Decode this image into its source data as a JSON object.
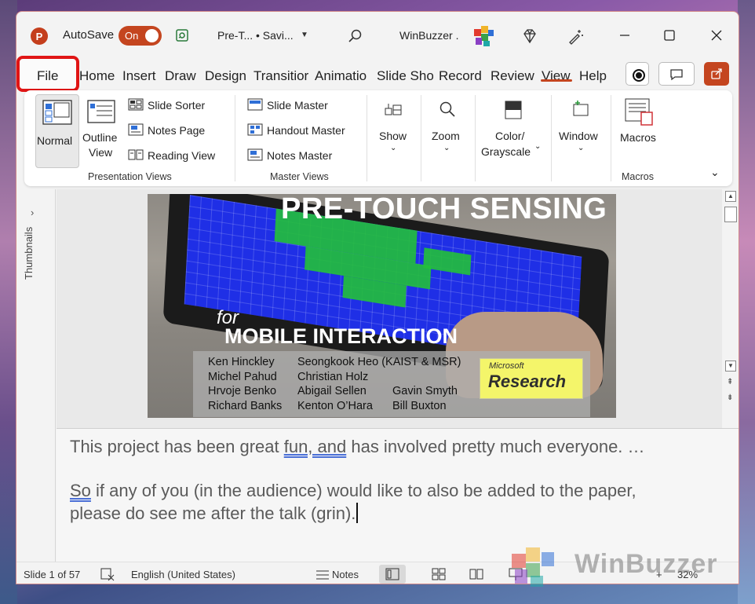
{
  "app": {
    "logo_letter": "P",
    "autosave_label": "AutoSave",
    "autosave_state": "On",
    "doc_title": "Pre-T... • Savi...",
    "user_name": "WinBuzzer ."
  },
  "tabs": [
    "File",
    "Home",
    "Insert",
    "Draw",
    "Design",
    "Transitior",
    "Animatio",
    "Slide Sho",
    "Record",
    "Review",
    "View",
    "Help"
  ],
  "active_tab": "View",
  "ribbon": {
    "presentation_views": {
      "normal": "Normal",
      "outline_line1": "Outline",
      "outline_line2": "View",
      "slide_sorter": "Slide Sorter",
      "notes_page": "Notes Page",
      "reading_view": "Reading View",
      "group_label": "Presentation Views"
    },
    "master_views": {
      "slide_master": "Slide Master",
      "handout_master": "Handout Master",
      "notes_master": "Notes Master",
      "group_label": "Master Views"
    },
    "show": "Show",
    "zoom": "Zoom",
    "color_line1": "Color/",
    "color_line2": "Grayscale",
    "window": "Window",
    "macros": "Macros",
    "macros_group_label": "Macros"
  },
  "sidebar": {
    "thumbnails_label": "Thumbnails"
  },
  "slide": {
    "title": "PRE-TOUCH SENSING",
    "for_text": "for",
    "subtitle": "MOBILE INTERACTION",
    "authors_col1": [
      "Ken Hinckley",
      "Michel Pahud",
      "Hrvoje Benko",
      "Richard Banks"
    ],
    "authors_col2": [
      "Seongkook Heo (KAIST & MSR)",
      "Christian Holz",
      "Abigail Sellen",
      "Kenton O’Hara"
    ],
    "authors_col3": [
      "Gavin Smyth",
      "Bill Buxton"
    ],
    "logo_small": "Microsoft",
    "logo_big": "Research"
  },
  "notes": {
    "line1_pre": "This project has been great ",
    "line1_flag": "fun, and",
    "line1_post": " has involved pretty much everyone. …",
    "line2_flag": "So",
    "line2_post": " if any of you (in the audience) would like to also be added to the paper,",
    "line3": "please do see me after the talk (grin)."
  },
  "status": {
    "slide_info": "Slide 1 of 57",
    "language": "English (United States)",
    "notes_label": "Notes",
    "zoom_level": "32%"
  },
  "watermark": "WinBuzzer",
  "colors": {
    "accent": "#c4451f",
    "file_highlight": "#e01515",
    "heatmap_blue": "#1f2fe6",
    "heatmap_green": "#22c03a"
  }
}
